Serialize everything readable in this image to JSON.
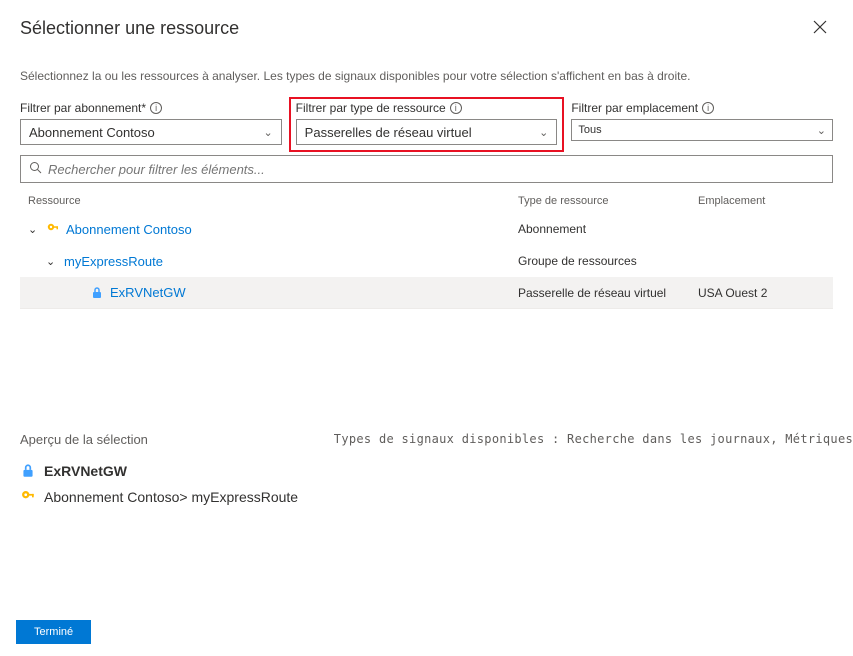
{
  "header": {
    "title": "Sélectionner une ressource"
  },
  "instructions": "Sélectionnez la ou les ressources à analyser. Les types de signaux disponibles pour votre sélection s'affichent en bas à droite.",
  "filters": {
    "subscription": {
      "label": "Filtrer par abonnement*",
      "value": "Abonnement Contoso"
    },
    "resourceType": {
      "label": "Filtrer par type de ressource",
      "value": "Passerelles de réseau virtuel"
    },
    "location": {
      "label": "Filtrer par emplacement",
      "value": "Tous"
    }
  },
  "search": {
    "placeholder": "Rechercher pour filtrer les éléments..."
  },
  "columns": {
    "resource": "Ressource",
    "type": "Type de ressource",
    "location": "Emplacement"
  },
  "tree": {
    "subscription": {
      "name": "Abonnement Contoso",
      "type": "Abonnement"
    },
    "group": {
      "name": "myExpressRoute",
      "type": "Groupe de ressources"
    },
    "resource": {
      "name": "ExRVNetGW",
      "type": "Passerelle de réseau virtuel",
      "location": "USA Ouest 2"
    }
  },
  "preview": {
    "title": "Aperçu de la sélection",
    "signals": "Types de signaux disponibles : Recherche dans les journaux, Métriques",
    "resource": "ExRVNetGW",
    "path": "Abonnement Contoso> myExpressRoute"
  },
  "footer": {
    "done": "Terminé"
  }
}
